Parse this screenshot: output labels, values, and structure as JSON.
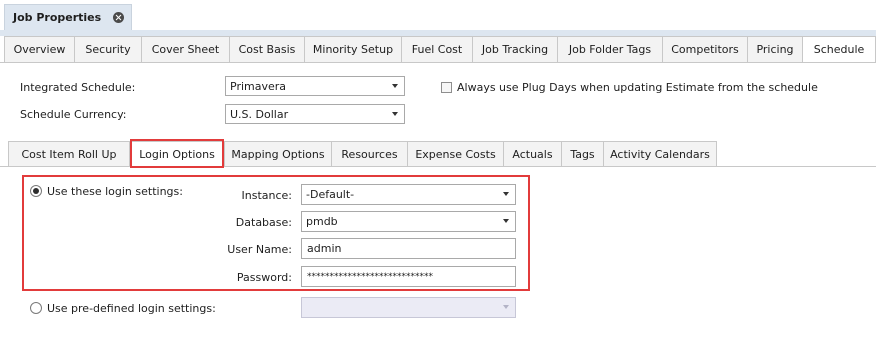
{
  "document_tab": {
    "title": "Job Properties",
    "close_icon": "close-icon"
  },
  "tabs": [
    {
      "label": "Overview"
    },
    {
      "label": "Security"
    },
    {
      "label": "Cover Sheet"
    },
    {
      "label": "Cost Basis"
    },
    {
      "label": "Minority Setup"
    },
    {
      "label": "Fuel Cost"
    },
    {
      "label": "Job Tracking"
    },
    {
      "label": "Job Folder Tags"
    },
    {
      "label": "Competitors"
    },
    {
      "label": "Pricing"
    },
    {
      "label": "Schedule"
    }
  ],
  "schedule": {
    "integrated_label": "Integrated Schedule:",
    "integrated_value": "Primavera",
    "currency_label": "Schedule Currency:",
    "currency_value": "U.S. Dollar",
    "plug_days_label": "Always use Plug Days when updating Estimate from the schedule",
    "plug_days_checked": false
  },
  "subtabs": [
    {
      "label": "Cost Item Roll Up"
    },
    {
      "label": "Login Options"
    },
    {
      "label": "Mapping Options"
    },
    {
      "label": "Resources"
    },
    {
      "label": "Expense Costs"
    },
    {
      "label": "Actuals"
    },
    {
      "label": "Tags"
    },
    {
      "label": "Activity Calendars"
    }
  ],
  "login": {
    "use_these_label": "Use these login settings:",
    "instance_label": "Instance:",
    "instance_value": "-Default-",
    "database_label": "Database:",
    "database_value": "pmdb",
    "username_label": "User Name:",
    "username_value": "admin",
    "password_label": "Password:",
    "password_value": "****************************",
    "predefined_label": "Use pre-defined login settings:",
    "predefined_value": ""
  },
  "highlight_color": "#e23b3b"
}
